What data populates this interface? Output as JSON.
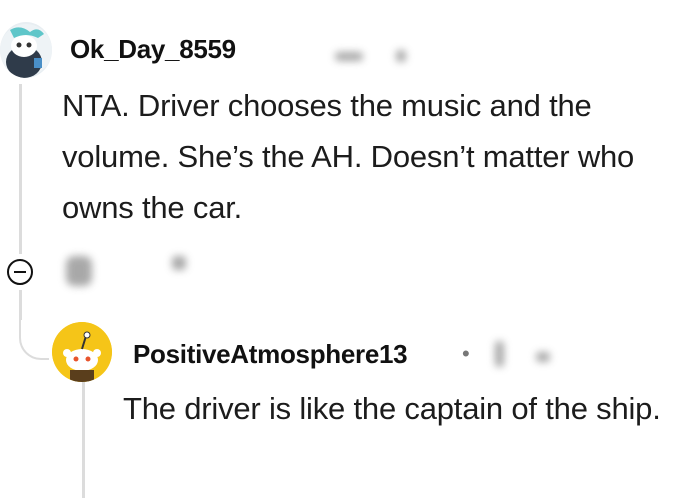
{
  "comment": {
    "username": "Ok_Day_8559",
    "text": "NTA. Driver chooses the music and the volume. She’s the AH. Doesn’t matter who owns the car."
  },
  "reply": {
    "username": "PositiveAtmosphere13",
    "separator": "•",
    "text": "The driver is like the captain of the ship."
  },
  "colors": {
    "avatar_reply_bg": "#f5c518",
    "thread_line": "#dcdcdc"
  },
  "icons": [
    "user-avatar-icon",
    "collapse-icon",
    "snoo-avatar-icon"
  ]
}
